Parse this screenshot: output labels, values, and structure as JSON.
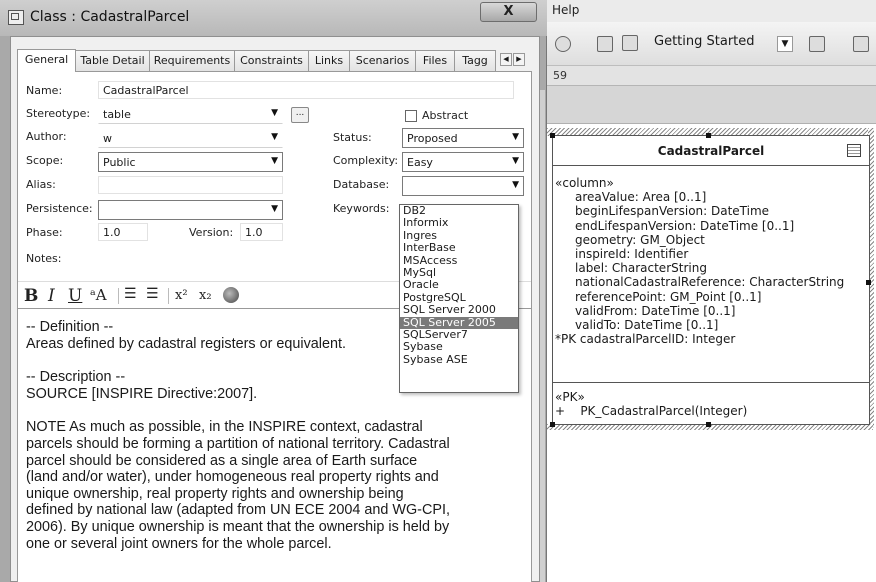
{
  "background_app": {
    "menu_help": "Help",
    "toolbar_combo": "Getting Started",
    "tabstrip_text": "59"
  },
  "uml": {
    "class_name": "CadastralParcel",
    "stereotype_attrs": "«column»",
    "attributes": [
      "areaValue: Area [0..1]",
      "beginLifespanVersion: DateTime",
      "endLifespanVersion: DateTime [0..1]",
      "geometry: GM_Object",
      "inspireId: Identifier",
      "label: CharacterString",
      "nationalCadastralReference: CharacterString",
      "referencePoint: GM_Point [0..1]",
      "validFrom: DateTime [0..1]",
      "validTo: DateTime [0..1]"
    ],
    "pk_attribute": "*PK cadastralParcelID: Integer",
    "stereotype_ops": "«PK»",
    "operation": "+    PK_CadastralParcel(Integer)"
  },
  "dialog": {
    "title": "Class : CadastralParcel",
    "close_label": "X",
    "tabs": [
      "General",
      "Table Detail",
      "Requirements",
      "Constraints",
      "Links",
      "Scenarios",
      "Files",
      "Tagg"
    ],
    "form": {
      "name_label": "Name:",
      "name_value": "CadastralParcel",
      "stereotype_label": "Stereotype:",
      "stereotype_value": "table",
      "browse_label": "...",
      "abstract_label": "Abstract",
      "author_label": "Author:",
      "author_value": "w",
      "status_label": "Status:",
      "status_value": "Proposed",
      "scope_label": "Scope:",
      "scope_value": "Public",
      "complexity_label": "Complexity:",
      "complexity_value": "Easy",
      "alias_label": "Alias:",
      "alias_value": "",
      "database_label": "Database:",
      "database_value": "",
      "persistence_label": "Persistence:",
      "persistence_value": "",
      "keywords_label": "Keywords:",
      "phase_label": "Phase:",
      "phase_value": "1.0",
      "version_label": "Version:",
      "version_value": "1.0",
      "notes_label": "Notes:"
    },
    "format_toolbar": {
      "bold": "B",
      "italic": "I",
      "underline": "U",
      "font_color": "ᵃA",
      "bullets": "☰",
      "numbering": "☰",
      "superscript": "x²",
      "subscript": "x₂"
    },
    "notes": {
      "definition_header": "-- Definition --",
      "definition_text": "Areas defined by cadastral registers or equivalent.",
      "description_header": "-- Description --",
      "source": "SOURCE [INSPIRE Directive:2007].",
      "note_lines": [
        "NOTE As much as possible, in the INSPIRE context, cadastral",
        "parcels should be forming a partition of national territory. Cadastral",
        "parcel should be considered as a single area of Earth surface",
        "(land and/or water), under homogeneous real property rights and",
        "unique ownership, real property rights and ownership being",
        "defined by national law (adapted from UN ECE 2004 and WG-CPI,",
        "2006). By unique ownership is meant that the ownership is held by",
        "one or several joint owners for the whole parcel."
      ]
    },
    "database_options": [
      "DB2",
      "Informix",
      "Ingres",
      "InterBase",
      "MSAccess",
      "MySql",
      "Oracle",
      "PostgreSQL",
      "SQL Server 2000",
      "SQL Server 2005",
      "SQLServer7",
      "Sybase",
      "Sybase ASE"
    ],
    "database_highlighted": "SQL Server 2005"
  }
}
